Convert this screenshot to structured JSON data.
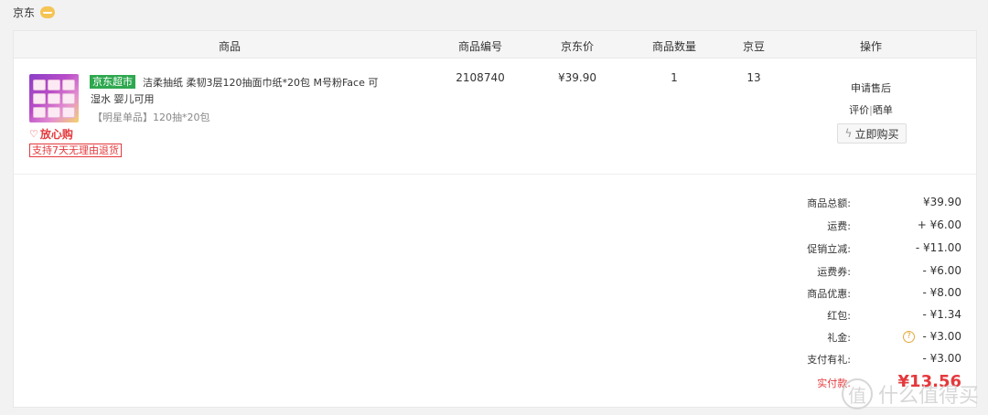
{
  "shop": {
    "name": "京东"
  },
  "table": {
    "headers": {
      "product": "商品",
      "sku": "商品编号",
      "price": "京东价",
      "quantity": "商品数量",
      "jingdou": "京豆",
      "actions": "操作"
    }
  },
  "item": {
    "badge": "京东超市",
    "name": "洁柔抽纸 柔韧3层120抽面巾纸*20包 M号粉Face 可湿水 婴儿可用",
    "spec": "【明星单品】120抽*20包",
    "tag_fangxin": "放心购",
    "tag_support": "支持7天无理由退货",
    "sku": "2108740",
    "price": "¥39.90",
    "quantity": "1",
    "jingdou": "13",
    "actions": {
      "after_sales": "申请售后",
      "review": "评价",
      "separator": "|",
      "show": "晒单",
      "buy_now": "立即购买"
    }
  },
  "summary": [
    {
      "label": "商品总额:",
      "value": "¥39.90"
    },
    {
      "label": "运费:",
      "value": "+ ¥6.00"
    },
    {
      "label": "促销立减:",
      "value": "- ¥11.00"
    },
    {
      "label": "运费券:",
      "value": "- ¥6.00"
    },
    {
      "label": "商品优惠:",
      "value": "- ¥8.00"
    },
    {
      "label": "红包:",
      "value": "- ¥1.34"
    },
    {
      "label": "礼金:",
      "value": "- ¥3.00"
    },
    {
      "label": "支付有礼:",
      "value": "- ¥3.00"
    }
  ],
  "total": {
    "label": "实付款:",
    "value": "¥13.56"
  },
  "watermark": {
    "text": "什么值得买",
    "logo": "值"
  },
  "colors": {
    "accent_red": "#e4393c",
    "jd_supermarket_green": "#2ea84f",
    "help_orange": "#e3a93a"
  },
  "icons": {
    "shop_chat": "chat-bubble-icon",
    "fangxin": "heart-icon",
    "buy_now": "lightning-icon",
    "gift_help": "question-circle-icon"
  }
}
